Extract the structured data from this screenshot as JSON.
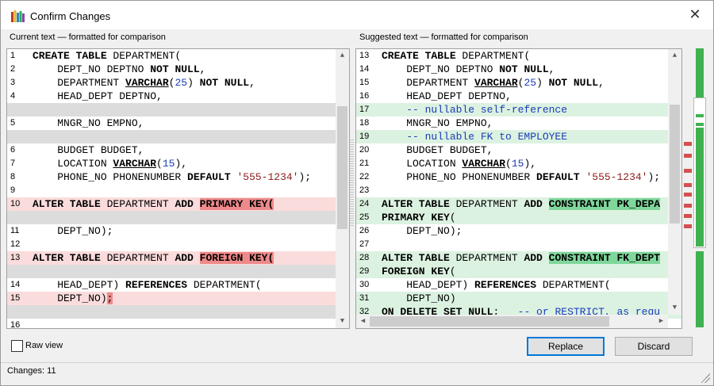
{
  "window": {
    "title": "Confirm Changes",
    "app_icon": "books-icon",
    "close_glyph": "✕"
  },
  "left_panel": {
    "caption": "Current text — formatted for comparison",
    "lines": [
      {
        "num": "1",
        "bg": "",
        "segs": [
          {
            "t": "CREATE TABLE",
            "c": "kw"
          },
          {
            "t": " DEPARTMENT("
          }
        ]
      },
      {
        "num": "2",
        "bg": "",
        "segs": [
          {
            "t": "    DEPT_NO DEPTNO "
          },
          {
            "t": "NOT NULL",
            "c": "kw"
          },
          {
            "t": ","
          }
        ]
      },
      {
        "num": "3",
        "bg": "",
        "segs": [
          {
            "t": "    DEPARTMENT "
          },
          {
            "t": "VARCHAR",
            "c": "kw ul"
          },
          {
            "t": "("
          },
          {
            "t": "25",
            "c": "num"
          },
          {
            "t": ") "
          },
          {
            "t": "NOT NULL",
            "c": "kw"
          },
          {
            "t": ","
          }
        ]
      },
      {
        "num": "4",
        "bg": "",
        "segs": [
          {
            "t": "    HEAD_DEPT DEPTNO,"
          }
        ]
      },
      {
        "num": "",
        "bg": "gap",
        "segs": []
      },
      {
        "num": "5",
        "bg": "",
        "segs": [
          {
            "t": "    MNGR_NO EMPNO,"
          }
        ]
      },
      {
        "num": "",
        "bg": "gap",
        "segs": []
      },
      {
        "num": "6",
        "bg": "",
        "segs": [
          {
            "t": "    BUDGET BUDGET,"
          }
        ]
      },
      {
        "num": "7",
        "bg": "",
        "segs": [
          {
            "t": "    LOCATION "
          },
          {
            "t": "VARCHAR",
            "c": "kw ul"
          },
          {
            "t": "("
          },
          {
            "t": "15",
            "c": "num"
          },
          {
            "t": "),"
          }
        ]
      },
      {
        "num": "8",
        "bg": "",
        "segs": [
          {
            "t": "    PHONE_NO PHONENUMBER "
          },
          {
            "t": "DEFAULT",
            "c": "kw"
          },
          {
            "t": " "
          },
          {
            "t": "'555-1234'",
            "c": "str"
          },
          {
            "t": ");"
          }
        ]
      },
      {
        "num": "9",
        "bg": "",
        "segs": []
      },
      {
        "num": "10",
        "bg": "del",
        "segs": [
          {
            "t": "ALTER TABLE",
            "c": "kw"
          },
          {
            "t": " DEPARTMENT "
          },
          {
            "t": "ADD",
            "c": "kw"
          },
          {
            "t": " "
          },
          {
            "t": "PRIMARY KEY(",
            "c": "kw hl-del"
          }
        ]
      },
      {
        "num": "",
        "bg": "gap",
        "segs": []
      },
      {
        "num": "11",
        "bg": "",
        "segs": [
          {
            "t": "    DEPT_NO);"
          }
        ]
      },
      {
        "num": "12",
        "bg": "",
        "segs": []
      },
      {
        "num": "13",
        "bg": "del",
        "segs": [
          {
            "t": "ALTER TABLE",
            "c": "kw"
          },
          {
            "t": " DEPARTMENT "
          },
          {
            "t": "ADD",
            "c": "kw"
          },
          {
            "t": " "
          },
          {
            "t": "FOREIGN KEY(",
            "c": "kw hl-del"
          }
        ]
      },
      {
        "num": "",
        "bg": "gap",
        "segs": []
      },
      {
        "num": "14",
        "bg": "",
        "segs": [
          {
            "t": "    HEAD_DEPT) "
          },
          {
            "t": "REFERENCES",
            "c": "kw"
          },
          {
            "t": " DEPARTMENT("
          }
        ]
      },
      {
        "num": "15",
        "bg": "del",
        "segs": [
          {
            "t": "    DEPT_NO)"
          },
          {
            "t": ";",
            "c": "hl-del"
          }
        ]
      },
      {
        "num": "",
        "bg": "gap",
        "segs": []
      },
      {
        "num": "16",
        "bg": "",
        "segs": []
      }
    ]
  },
  "right_panel": {
    "caption": "Suggested text — formatted for comparison",
    "lines": [
      {
        "num": "13",
        "bg": "",
        "segs": [
          {
            "t": "CREATE TABLE",
            "c": "kw"
          },
          {
            "t": " DEPARTMENT("
          }
        ]
      },
      {
        "num": "14",
        "bg": "",
        "segs": [
          {
            "t": "    DEPT_NO DEPTNO "
          },
          {
            "t": "NOT NULL",
            "c": "kw"
          },
          {
            "t": ","
          }
        ]
      },
      {
        "num": "15",
        "bg": "",
        "segs": [
          {
            "t": "    DEPARTMENT "
          },
          {
            "t": "VARCHAR",
            "c": "kw ul"
          },
          {
            "t": "("
          },
          {
            "t": "25",
            "c": "num"
          },
          {
            "t": ") "
          },
          {
            "t": "NOT NULL",
            "c": "kw"
          },
          {
            "t": ","
          }
        ]
      },
      {
        "num": "16",
        "bg": "",
        "segs": [
          {
            "t": "    HEAD_DEPT DEPTNO,"
          }
        ]
      },
      {
        "num": "17",
        "bg": "add",
        "segs": [
          {
            "t": "    -- nullable self-reference",
            "c": "cm"
          }
        ]
      },
      {
        "num": "18",
        "bg": "",
        "segs": [
          {
            "t": "    MNGR_NO EMPNO,"
          }
        ]
      },
      {
        "num": "19",
        "bg": "add",
        "segs": [
          {
            "t": "    -- nullable FK to EMPLOYEE",
            "c": "cm"
          }
        ]
      },
      {
        "num": "20",
        "bg": "",
        "segs": [
          {
            "t": "    BUDGET BUDGET,"
          }
        ]
      },
      {
        "num": "21",
        "bg": "",
        "segs": [
          {
            "t": "    LOCATION "
          },
          {
            "t": "VARCHAR",
            "c": "kw ul"
          },
          {
            "t": "("
          },
          {
            "t": "15",
            "c": "num"
          },
          {
            "t": "),"
          }
        ]
      },
      {
        "num": "22",
        "bg": "",
        "segs": [
          {
            "t": "    PHONE_NO PHONENUMBER "
          },
          {
            "t": "DEFAULT",
            "c": "kw"
          },
          {
            "t": " "
          },
          {
            "t": "'555-1234'",
            "c": "str"
          },
          {
            "t": ");"
          }
        ]
      },
      {
        "num": "23",
        "bg": "",
        "segs": []
      },
      {
        "num": "24",
        "bg": "add",
        "segs": [
          {
            "t": "ALTER TABLE",
            "c": "kw"
          },
          {
            "t": " DEPARTMENT "
          },
          {
            "t": "ADD",
            "c": "kw"
          },
          {
            "t": " "
          },
          {
            "t": "CONSTRAINT PK_DEPA",
            "c": "kw hl-add"
          }
        ]
      },
      {
        "num": "25",
        "bg": "add",
        "segs": [
          {
            "t": "PRIMARY KEY",
            "c": "kw"
          },
          {
            "t": "("
          }
        ]
      },
      {
        "num": "26",
        "bg": "",
        "segs": [
          {
            "t": "    DEPT_NO);"
          }
        ]
      },
      {
        "num": "27",
        "bg": "",
        "segs": []
      },
      {
        "num": "28",
        "bg": "add",
        "segs": [
          {
            "t": "ALTER TABLE",
            "c": "kw"
          },
          {
            "t": " DEPARTMENT "
          },
          {
            "t": "ADD",
            "c": "kw"
          },
          {
            "t": " "
          },
          {
            "t": "CONSTRAINT FK_DEPT",
            "c": "kw hl-add"
          }
        ]
      },
      {
        "num": "29",
        "bg": "add",
        "segs": [
          {
            "t": "FOREIGN KEY",
            "c": "kw"
          },
          {
            "t": "("
          }
        ]
      },
      {
        "num": "30",
        "bg": "",
        "segs": [
          {
            "t": "    HEAD_DEPT) "
          },
          {
            "t": "REFERENCES",
            "c": "kw"
          },
          {
            "t": " DEPARTMENT("
          }
        ]
      },
      {
        "num": "31",
        "bg": "add",
        "segs": [
          {
            "t": "    DEPT_NO)"
          }
        ]
      },
      {
        "num": "32",
        "bg": "add",
        "segs": [
          {
            "t": "ON DELETE SET NULL",
            "c": "kw"
          },
          {
            "t": ";   "
          },
          {
            "t": "-- or RESTRICT, as requ",
            "c": "cm"
          }
        ]
      }
    ]
  },
  "footer": {
    "raw_view_label": "Raw view",
    "raw_view_checked": false,
    "replace_label": "Replace",
    "discard_label": "Discard"
  },
  "status": {
    "text": "Changes: 11"
  },
  "colors": {
    "deleted_line": "#fbdcdc",
    "deleted_highlight": "#ef8a8a",
    "added_line": "#dcf2e1",
    "added_highlight": "#7fd79b",
    "gap_line": "#dcdcdc",
    "overview_change": "#d45050",
    "overview_added": "#3fb14f"
  }
}
